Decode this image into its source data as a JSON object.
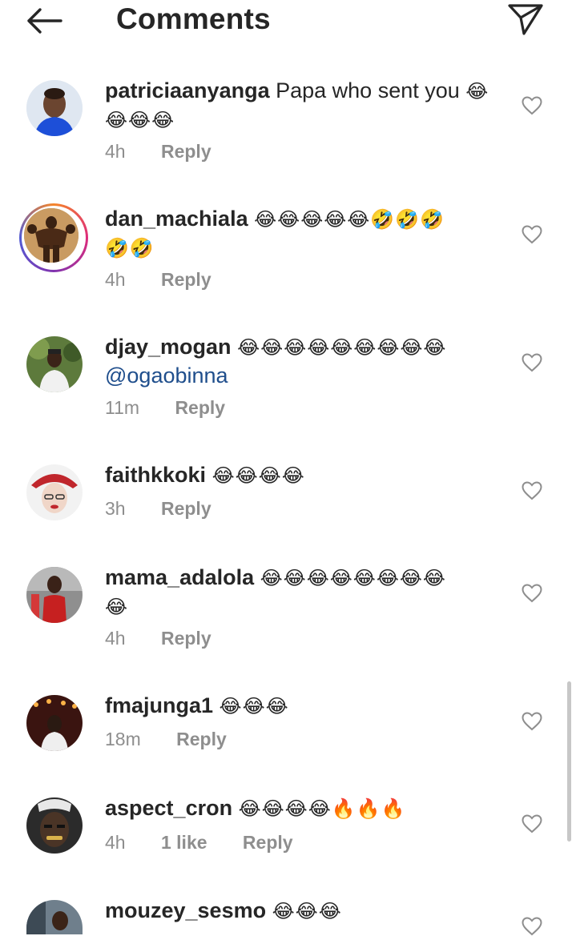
{
  "header": {
    "title": "Comments",
    "back_icon": "arrow-left-icon",
    "send_icon": "paper-plane-icon"
  },
  "comments": [
    {
      "username": "patriciaanyanga",
      "text": "Papa who sent you",
      "emojis": "😂",
      "emojis_line2": "😂😂😂",
      "time": "4h",
      "reply": "Reply"
    },
    {
      "username": "dan_machiala",
      "emojis": "😂😂😂😂😂🤣🤣🤣",
      "emojis_line2": "🤣🤣",
      "time": "4h",
      "reply": "Reply",
      "story_ring": true
    },
    {
      "username": "djay_mogan",
      "emojis": "😂😂😂😂😂😂😂😂😂",
      "mention": "@ogaobinna",
      "time": "11m",
      "reply": "Reply"
    },
    {
      "username": "faithkkoki",
      "emojis": "😂😂😂😂",
      "time": "3h",
      "reply": "Reply"
    },
    {
      "username": "mama_adalola",
      "emojis": "😂😂😂😂😂😂😂😂",
      "emojis_line2": "😂",
      "time": "4h",
      "reply": "Reply"
    },
    {
      "username": "fmajunga1",
      "emojis": "😂😂😂",
      "time": "18m",
      "reply": "Reply"
    },
    {
      "username": "aspect_cron",
      "emojis": "😂😂😂😂🔥🔥🔥",
      "time": "4h",
      "likes": "1 like",
      "reply": "Reply"
    },
    {
      "username": "mouzey_sesmo",
      "emojis": "😂😂😂"
    }
  ],
  "colors": {
    "text": "#262626",
    "meta": "#8e8e8e",
    "mention": "#1f4e8c"
  }
}
